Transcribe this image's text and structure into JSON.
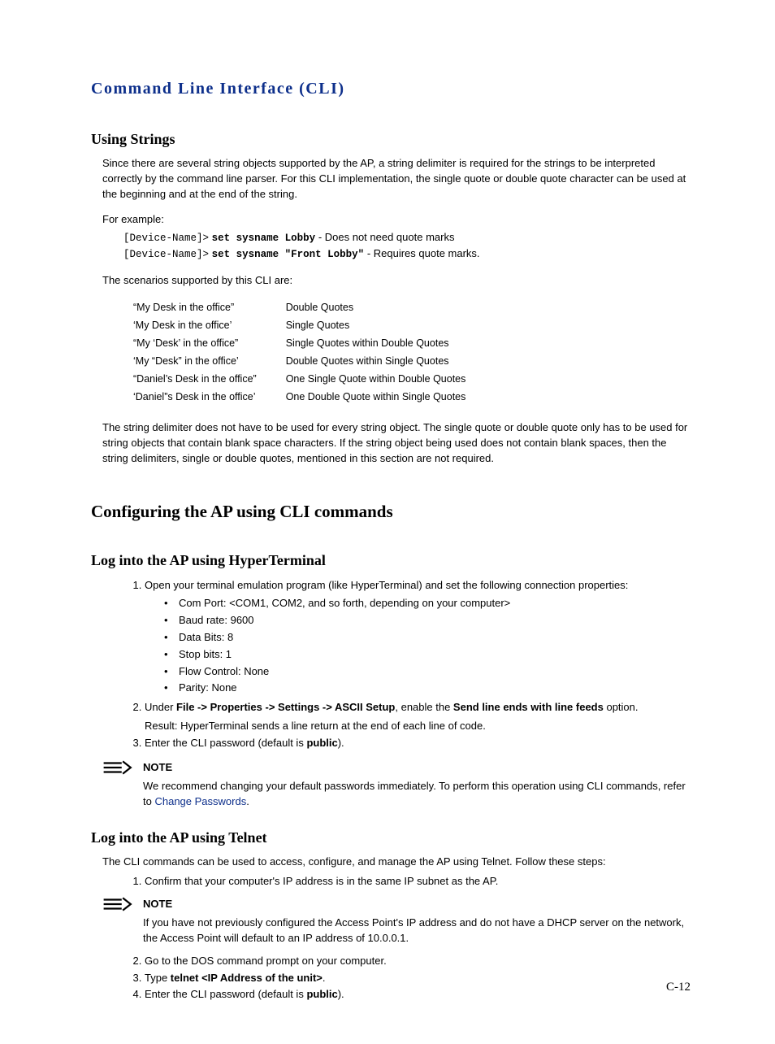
{
  "chapter_title": "Command Line Interface (CLI)",
  "pagenum": "C-12",
  "strings": {
    "h": "Using Strings",
    "p1": "Since there are several string objects supported by the AP, a string delimiter is required for the strings to be interpreted correctly by the command line parser. For this CLI implementation, the single quote or double quote character can be used at the beginning and at the end of the string.",
    "for_example": "For example:",
    "ex1_prompt": "[Device-Name]>",
    "ex1_cmd": "set sysname Lobby",
    "ex1_tail": " - Does not need quote marks",
    "ex2_prompt": "[Device-Name]>",
    "ex2_cmd": "set sysname \"Front Lobby\"",
    "ex2_tail": " - Requires quote marks.",
    "scenarios_lead": "The scenarios supported by this CLI are:",
    "rows": [
      {
        "s": "“My Desk in the office”",
        "d": "Double Quotes"
      },
      {
        "s": "‘My Desk in the office’",
        "d": "Single Quotes"
      },
      {
        "s": "“My ‘Desk’ in the office”",
        "d": "Single Quotes within Double Quotes"
      },
      {
        "s": "‘My “Desk” in the office’",
        "d": "Double Quotes within Single Quotes"
      },
      {
        "s": "“Daniel’s Desk in the office”",
        "d": "One Single Quote within Double Quotes"
      },
      {
        "s": "‘Daniel”s Desk in the office’",
        "d": "One Double Quote within Single Quotes"
      }
    ],
    "p2": "The string delimiter does not have to be used for every string object. The single quote or double quote only has to be used for string objects that contain blank space characters. If the string object being used does not contain blank spaces, then the string delimiters, single or double quotes, mentioned in this section are not required."
  },
  "config": {
    "h": "Configuring the AP using CLI commands",
    "hyper": {
      "h": "Log into the AP using HyperTerminal",
      "s1": "Open your terminal emulation program (like HyperTerminal) and set the following connection properties:",
      "props": [
        "Com Port: <COM1, COM2, and so forth, depending on your computer>",
        "Baud rate: 9600",
        "Data Bits: 8",
        "Stop bits: 1",
        "Flow Control: None",
        "Parity: None"
      ],
      "s2_pre": "Under ",
      "s2_b1": "File -> Properties -> Settings -> ASCII Setup",
      "s2_mid": ", enable the ",
      "s2_b2": "Send line ends with line feeds",
      "s2_post": " option.",
      "s2_result": "Result: HyperTerminal sends a line return at the end of each line of code.",
      "s3_pre": "Enter the CLI password (default is ",
      "s3_b": "public",
      "s3_post": ").",
      "note_head": "NOTE",
      "note_pre": "We recommend changing your default passwords immediately. To perform this operation using CLI commands, refer to ",
      "note_link": "Change Passwords",
      "note_post": "."
    },
    "telnet": {
      "h": "Log into the AP using Telnet",
      "lead": "The CLI commands can be used to access, configure, and manage the AP using Telnet. Follow these steps:",
      "s1": "Confirm that your computer's IP address is in the same IP subnet as the AP.",
      "note_head": "NOTE",
      "note_body": "If you have not previously configured the Access Point's IP address and do not have a DHCP server on the network, the Access Point will default to an IP address of 10.0.0.1.",
      "s2": "Go to the DOS command prompt on your computer.",
      "s3_pre": "Type ",
      "s3_b": "telnet <IP Address of the unit>",
      "s3_post": ".",
      "s4_pre": "Enter the CLI password (default is ",
      "s4_b": "public",
      "s4_post": ")."
    }
  }
}
